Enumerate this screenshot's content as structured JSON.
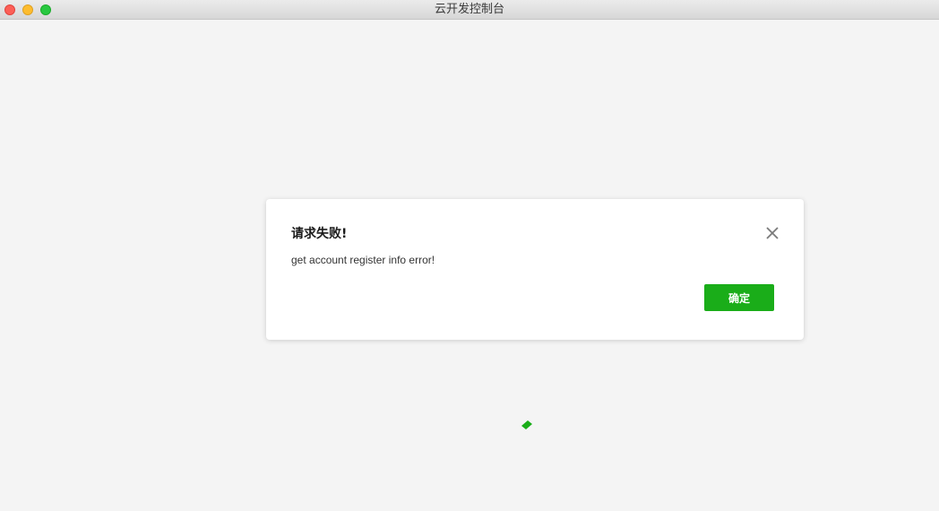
{
  "window": {
    "title": "云开发控制台"
  },
  "dialog": {
    "title": "请求失败!",
    "message": "get account register info error!",
    "confirm_label": "确定",
    "close_icon": "close-icon"
  },
  "loading": {
    "icon": "loading-spinner-icon"
  },
  "colors": {
    "accent": "#1aad19",
    "background": "#f4f4f4"
  }
}
